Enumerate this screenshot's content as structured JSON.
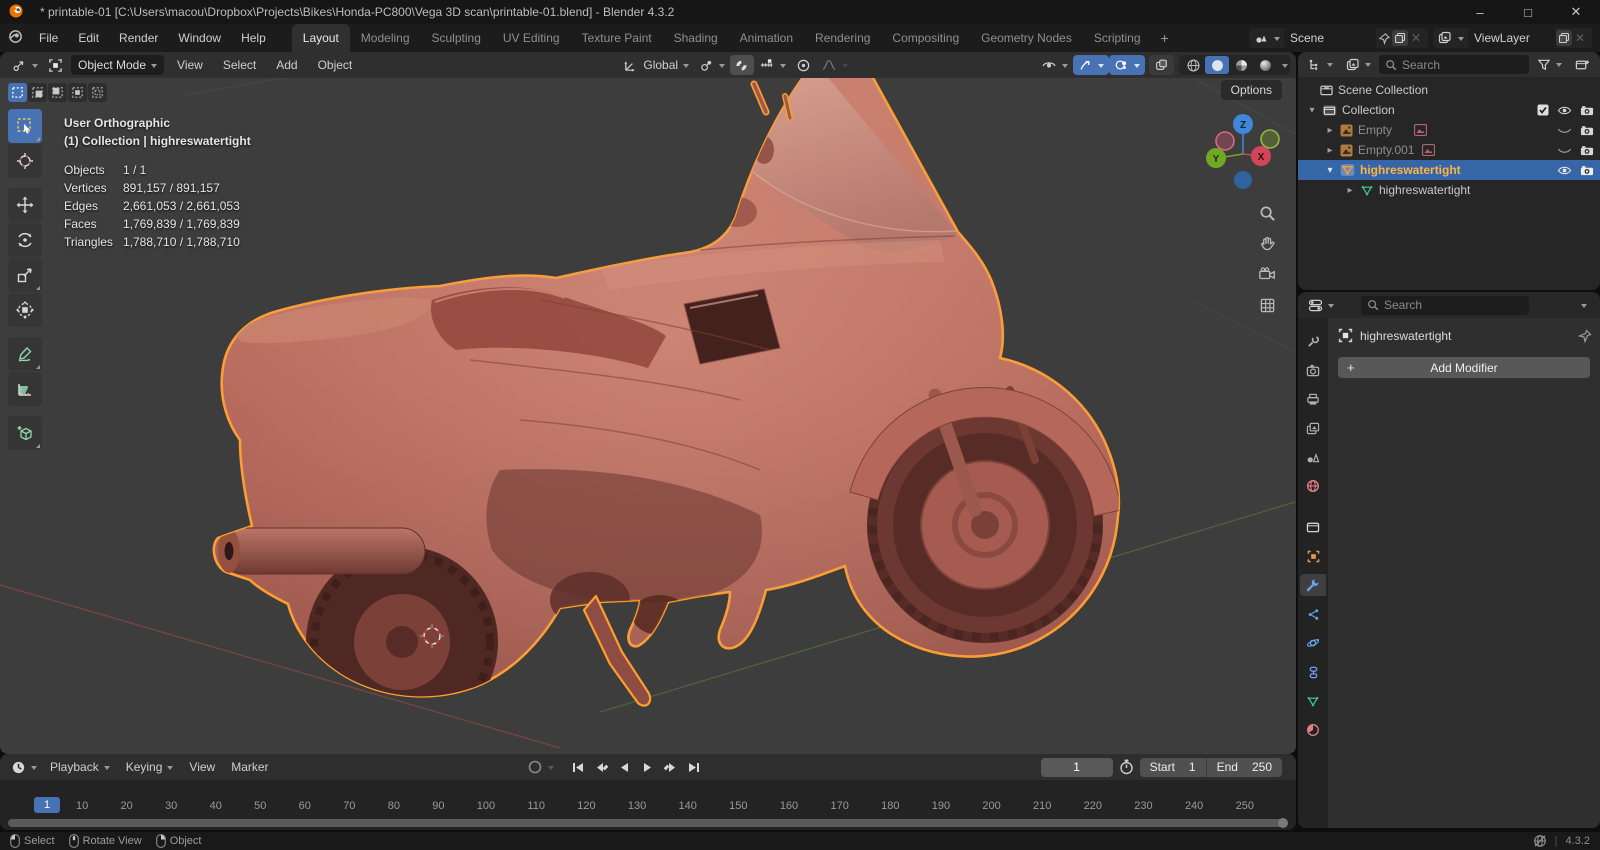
{
  "window": {
    "title": "* printable-01 [C:\\Users\\macou\\Dropbox\\Projects\\Bikes\\Honda-PC800\\Vega 3D scan\\printable-01.blend] - Blender 4.3.2",
    "minimize": "–",
    "maximize": "□",
    "close": "✕"
  },
  "topbar": {
    "menus": [
      "File",
      "Edit",
      "Render",
      "Window",
      "Help"
    ],
    "workspaces": [
      "Layout",
      "Modeling",
      "Sculpting",
      "UV Editing",
      "Texture Paint",
      "Shading",
      "Animation",
      "Rendering",
      "Compositing",
      "Geometry Nodes",
      "Scripting"
    ],
    "add_tab": "+",
    "scene_value": "Scene",
    "viewlayer_value": "ViewLayer"
  },
  "viewport_header": {
    "mode": "Object Mode",
    "menus": [
      "View",
      "Select",
      "Add",
      "Object"
    ],
    "orientation": "Global",
    "options": "Options"
  },
  "viewport_overlay": {
    "view": "User Orthographic",
    "context": "(1) Collection | highreswatertight",
    "stats": [
      {
        "label": "Objects",
        "value": "1 / 1"
      },
      {
        "label": "Vertices",
        "value": "891,157 / 891,157"
      },
      {
        "label": "Edges",
        "value": "2,661,053 / 2,661,053"
      },
      {
        "label": "Faces",
        "value": "1,769,839 / 1,769,839"
      },
      {
        "label": "Triangles",
        "value": "1,788,710 / 1,788,710"
      }
    ]
  },
  "gizmo": {
    "z": "Z",
    "y": "Y",
    "x": "X"
  },
  "outliner": {
    "search_placeholder": "Search",
    "rows": [
      {
        "label": "Scene Collection"
      },
      {
        "label": "Collection"
      },
      {
        "label": "Empty"
      },
      {
        "label": "Empty.001"
      },
      {
        "label": "highreswatertight"
      },
      {
        "label": "highreswatertight"
      }
    ]
  },
  "properties": {
    "search_placeholder": "Search",
    "breadcrumb": "highreswatertight",
    "add_modifier": "Add Modifier"
  },
  "timeline": {
    "menus": [
      "Playback",
      "Keying",
      "View",
      "Marker"
    ],
    "current_frame": "1",
    "start_label": "Start",
    "start_value": "1",
    "end_label": "End",
    "end_value": "250",
    "ruler_ticks": [
      "10",
      "20",
      "30",
      "40",
      "50",
      "60",
      "70",
      "80",
      "90",
      "100",
      "110",
      "120",
      "130",
      "140",
      "150",
      "160",
      "170",
      "180",
      "190",
      "200",
      "210",
      "220",
      "230",
      "240",
      "250"
    ]
  },
  "statusbar": {
    "hints": [
      "Select",
      "Rotate View",
      "Object"
    ],
    "version": "4.3.2"
  },
  "icons": {
    "expander_open": "▾",
    "expander_closed": "▸"
  },
  "colors": {
    "accent_blue": "#4772b3",
    "selection_outline_orange": "#ff9e2c",
    "active_object_orange": "#ffb340",
    "model_clay": "#b26055",
    "axis_x": "#e25b64",
    "axis_y": "#71a823",
    "axis_z": "#3f87d9"
  }
}
